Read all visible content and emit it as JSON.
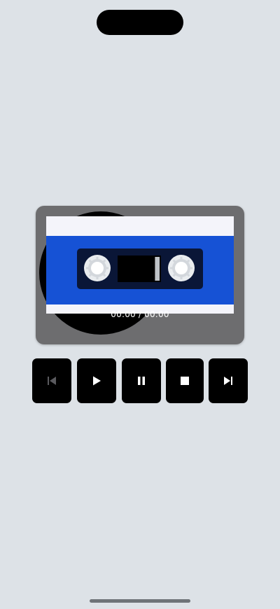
{
  "player": {
    "time_display": "00:00 / 00:00",
    "colors": {
      "body": "#6d6d6f",
      "label": "#f4f4fa",
      "band": "#1652d5",
      "window": "#0a1637"
    }
  },
  "controls": [
    {
      "name": "previous-button",
      "icon": "skip-previous-icon",
      "enabled": false
    },
    {
      "name": "play-button",
      "icon": "play-icon",
      "enabled": true
    },
    {
      "name": "pause-button",
      "icon": "pause-icon",
      "enabled": true
    },
    {
      "name": "stop-button",
      "icon": "stop-icon",
      "enabled": true
    },
    {
      "name": "next-button",
      "icon": "skip-next-icon",
      "enabled": true
    }
  ]
}
